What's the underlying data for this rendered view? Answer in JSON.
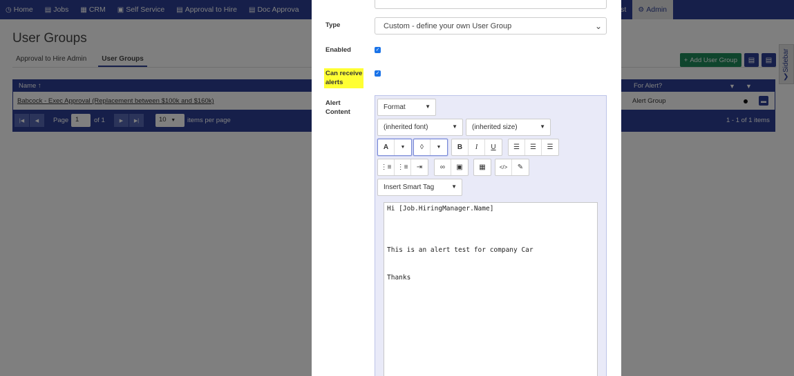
{
  "nav": {
    "items": [
      {
        "icon": "dashboard-icon",
        "glyph": "◷",
        "label": "Home"
      },
      {
        "icon": "folder-icon",
        "glyph": "▤",
        "label": "Jobs"
      },
      {
        "icon": "briefcase-icon",
        "glyph": "▦",
        "label": "CRM"
      },
      {
        "icon": "self-service-icon",
        "glyph": "▣",
        "label": "Self Service"
      },
      {
        "icon": "approval-icon",
        "glyph": "▤",
        "label": "Approval to Hire"
      },
      {
        "icon": "document-icon",
        "glyph": "▤",
        "label": "Doc Approva"
      }
    ],
    "right_items": [
      {
        "icon": "hr-assist-icon",
        "glyph": "▣",
        "label": "HR Assist"
      },
      {
        "icon": "gear-icon",
        "glyph": "⚙",
        "label": "Admin"
      }
    ]
  },
  "page": {
    "title": "User Groups",
    "tabs": [
      "Approval to Hire Admin",
      "User Groups"
    ],
    "add_button": "Add User Group",
    "sidebar_label": "Sidebar",
    "grid": {
      "col_name": "Name",
      "col_alert": "For Alert?",
      "row_name": "Babcock - Exec Approval (Replacement between $100k and $160k)",
      "row_alert": "Alert Group",
      "page_label": "Page",
      "page_value": "1",
      "of_label": "of 1",
      "page_size": "10",
      "items_per_page": "items per page",
      "summary": "1 - 1 of 1 items"
    }
  },
  "modal": {
    "type_label": "Type",
    "type_value": "Custom - define your own User Group",
    "enabled_label": "Enabled",
    "alerts_label_1": "Can receive",
    "alerts_label_2": "alerts",
    "content_label_1": "Alert",
    "content_label_2": "Content",
    "editor": {
      "format": "Format",
      "font": "(inherited font)",
      "size": "(inherited size)",
      "smart_tag": "Insert Smart Tag",
      "lines": [
        "Hi [Job.HiringManager.Name]",
        "This is an alert test for company Car",
        "Thanks"
      ]
    }
  }
}
